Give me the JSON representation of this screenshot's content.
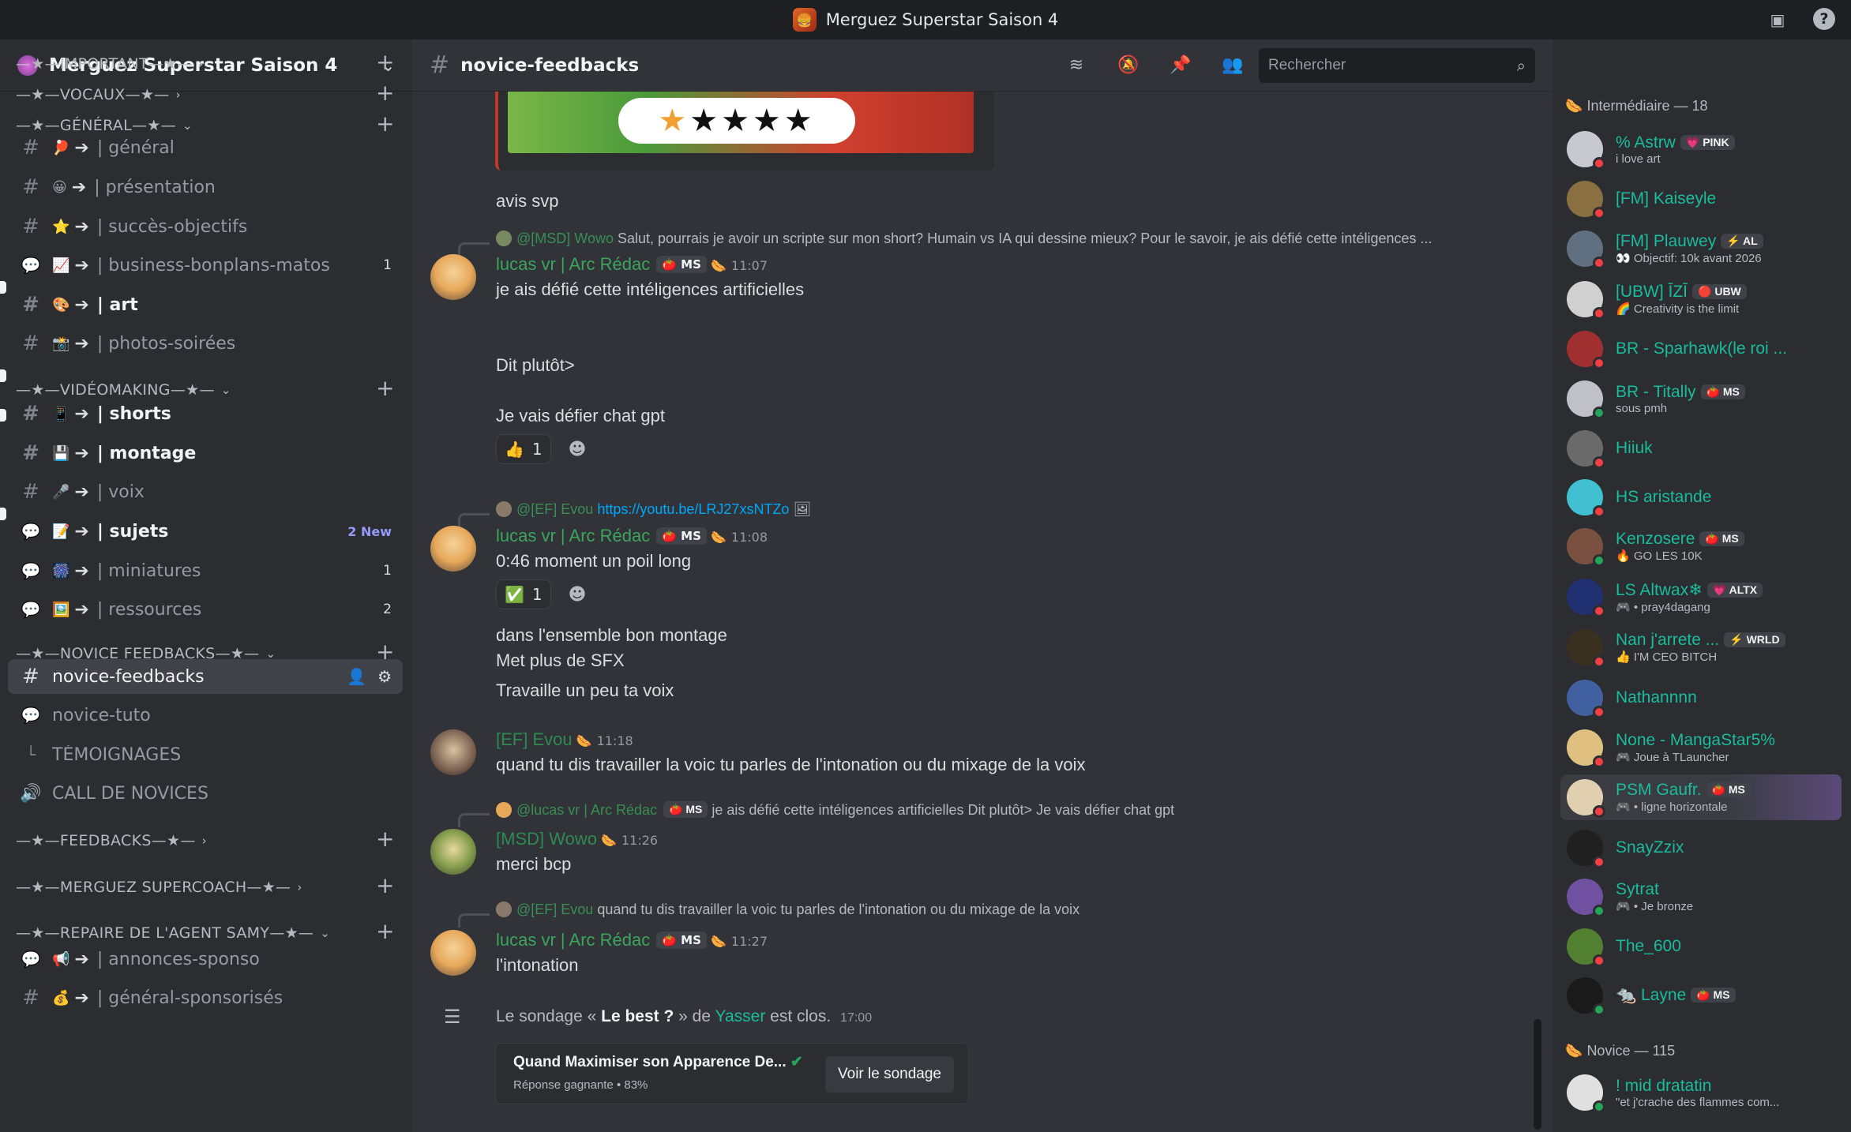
{
  "window": {
    "title": "Merguez Superstar Saison 4"
  },
  "server": {
    "name": "Merguez Superstar Saison 4"
  },
  "sidebar": {
    "categories": {
      "important": "—★—IMPORTANT—★— ›",
      "vocaux": "—★—VOCAUX—★—",
      "general": "—★—GÉNÉRAL—★—",
      "videomaking": "—★—VIDÉOMAKING—★—",
      "novice_feedbacks": "—★—NOVICE FEEDBACKS—★—",
      "feedbacks": "—★—FEEDBACKS—★—",
      "supercoach": "—★—MERGUEZ SUPERCOACH—★—",
      "agent_samy": "—★—REPAIRE DE L'AGENT SAMY—★—"
    },
    "channels": [
      {
        "emoji": "🏓",
        "label": "| général",
        "count": ""
      },
      {
        "emoji": "😀",
        "label": "| présentation",
        "count": ""
      },
      {
        "emoji": "⭐",
        "label": "| succès-objectifs",
        "count": ""
      },
      {
        "emoji": "📈",
        "label": "| business-bonplans-matos",
        "count": "1"
      },
      {
        "emoji": "🎨",
        "label": "| art",
        "count": ""
      },
      {
        "emoji": "📸",
        "label": "| photos-soirées",
        "count": ""
      },
      {
        "emoji": "📱",
        "label": "| shorts",
        "count": ""
      },
      {
        "emoji": "💾",
        "label": "| montage",
        "count": ""
      },
      {
        "emoji": "🎤",
        "label": "| voix",
        "count": ""
      },
      {
        "emoji": "📝",
        "label": "| sujets",
        "count": "2 New"
      },
      {
        "emoji": "🎆",
        "label": "| miniatures",
        "count": "1"
      },
      {
        "emoji": "🖼️",
        "label": "| ressources",
        "count": "2"
      },
      {
        "emoji": "",
        "label": "novice-feedbacks",
        "count": ""
      },
      {
        "emoji": "",
        "label": "novice-tuto",
        "count": ""
      },
      {
        "emoji": "",
        "label": "TÉMOIGNAGES",
        "count": ""
      },
      {
        "emoji": "",
        "label": "CALL DE NOVICES",
        "count": ""
      },
      {
        "emoji": "📢",
        "label": "| annonces-sponso",
        "count": ""
      },
      {
        "emoji": "💰",
        "label": "| général-sponsorisés",
        "count": ""
      }
    ],
    "arrow": "➔"
  },
  "header": {
    "channel": "novice-feedbacks",
    "search_placeholder": "Rechercher"
  },
  "messages": {
    "m0": {
      "text": "avis svp"
    },
    "m1": {
      "reply_user": "@[MSD] Wowo",
      "reply_text": "Salut, pourrais je avoir un scripte sur mon short? Humain vs IA qui dessine mieux? Pour le savoir, je ais défié cette intéligences ...",
      "user": "lucas vr | Arc Rédac",
      "badge": "MS",
      "time": "11:07",
      "line1": "je ais défié cette intéligences artificielles",
      "line2": "Dit plutôt>",
      "line3": "Je vais défier chat gpt",
      "reaction_count": "1"
    },
    "m2": {
      "reply_user": "@[EF] Evou",
      "reply_link": "https://youtu.be/LRJ27xsNTZo",
      "user": "lucas vr | Arc Rédac",
      "badge": "MS",
      "time": "11:08",
      "line1": "0:46 moment un poil long",
      "reaction_count": "1",
      "line2": "dans l'ensemble bon montage",
      "line3": "Met plus de SFX",
      "line4": "Travaille un peu ta voix"
    },
    "m3": {
      "user": "[EF] Evou",
      "time": "11:18",
      "line1": "quand tu dis travailler la voic tu parles de l'intonation ou du mixage de la voix"
    },
    "m4": {
      "reply_user": "@lucas vr | Arc Rédac",
      "reply_badge": "MS",
      "reply_text": "je ais défié cette intéligences artificielles  Dit plutôt>  Je vais défier chat gpt",
      "user": "[MSD] Wowo",
      "time": "11:26",
      "line1": "merci bcp"
    },
    "m5": {
      "reply_user": "@[EF] Evou",
      "reply_text": "quand tu dis travailler la voic tu parles de l'intonation ou du mixage de la voix",
      "user": "lucas vr | Arc Rédac",
      "badge": "MS",
      "time": "11:27",
      "line1": "l'intonation"
    },
    "poll": {
      "prefix": "Le sondage «",
      "title": "Le best ?",
      "middle": "» de",
      "author": "Yasser",
      "suffix": "est clos.",
      "time": "17:00",
      "answer": "Quand Maximiser son Apparence De...",
      "result": "Réponse gagnante • 83%",
      "button": "Voir le sondage"
    }
  },
  "members": {
    "group1": "Intermédiaire — 18",
    "group2": "Novice — 115",
    "list": [
      {
        "name": "% Astrw",
        "badge": "PINK",
        "sub": "i love art",
        "status": "dnd"
      },
      {
        "name": "[FM] Kaiseyle",
        "badge": "",
        "sub": "",
        "status": "dnd"
      },
      {
        "name": "[FM] Plauwey",
        "badge": "AL",
        "sub": "Objectif: 10k avant 2026",
        "status": "dnd"
      },
      {
        "name": "[UBW] ĪZĪ",
        "badge": "UBW",
        "sub": "Creativity is the limit",
        "status": "dnd"
      },
      {
        "name": "BR - Sparhawk(le roi ...",
        "badge": "",
        "sub": "",
        "status": "dnd"
      },
      {
        "name": "BR - Titally",
        "badge": "MS",
        "sub": "sous pmh",
        "status": "on"
      },
      {
        "name": "Hiiuk",
        "badge": "",
        "sub": "",
        "status": "dnd"
      },
      {
        "name": "HS aristande",
        "badge": "",
        "sub": "",
        "status": "dnd"
      },
      {
        "name": "Kenzosere",
        "badge": "MS",
        "sub": "GO LES 10K",
        "status": "on"
      },
      {
        "name": "LS Altwax❄",
        "badge": "ALTX",
        "sub": "• pray4dagang",
        "status": "dnd"
      },
      {
        "name": "Nan j'arrete ...",
        "badge": "WRLD",
        "sub": "I'M CEO BITCH",
        "status": "dnd"
      },
      {
        "name": "Nathannnn",
        "badge": "",
        "sub": "",
        "status": "dnd"
      },
      {
        "name": "None - MangaStar5%",
        "badge": "",
        "sub": "Joue à TLauncher",
        "status": "dnd"
      },
      {
        "name": "PSM Gaufr.",
        "badge": "MS",
        "sub": "• ligne horizontale",
        "status": "dnd"
      },
      {
        "name": "SnayZzix",
        "badge": "",
        "sub": "",
        "status": "dnd"
      },
      {
        "name": "Sytrat",
        "badge": "",
        "sub": "• Je bronze",
        "status": "on"
      },
      {
        "name": "The_600",
        "badge": "",
        "sub": "",
        "status": "dnd"
      },
      {
        "name": "Layne",
        "badge": "MS",
        "sub": "",
        "status": "on"
      },
      {
        "name": "! mid dratatin",
        "badge": "",
        "sub": "\"et j'crache des flammes com...",
        "status": "on"
      }
    ]
  }
}
